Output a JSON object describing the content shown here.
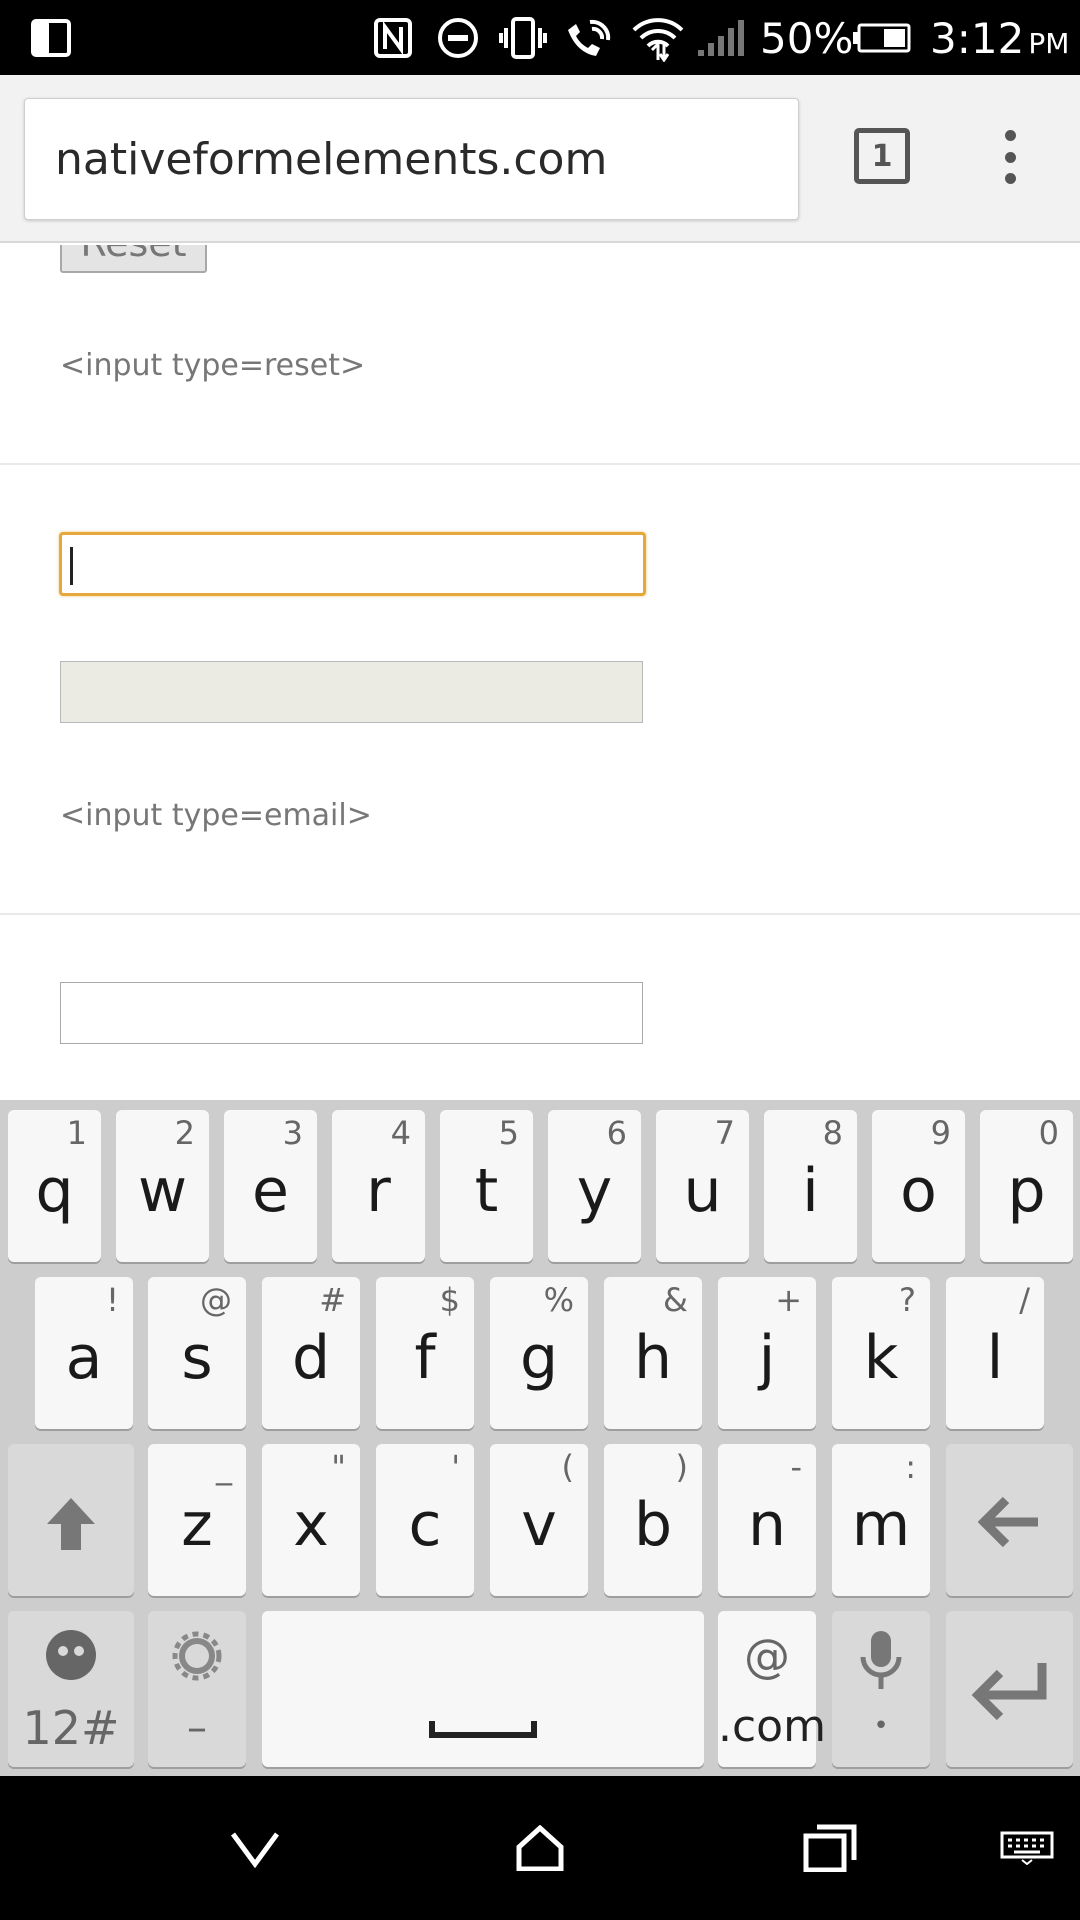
{
  "status_bar": {
    "battery": "50%",
    "time": "3:12",
    "ampm": "PM"
  },
  "browser": {
    "url": "nativeformelements.com",
    "tab_count": "1"
  },
  "page": {
    "reset_button_label": "Reset",
    "reset_caption": "<input type=reset>",
    "email_caption": "<input type=email>"
  },
  "keyboard": {
    "row1": [
      {
        "key": "q",
        "hint": "1"
      },
      {
        "key": "w",
        "hint": "2"
      },
      {
        "key": "e",
        "hint": "3"
      },
      {
        "key": "r",
        "hint": "4"
      },
      {
        "key": "t",
        "hint": "5"
      },
      {
        "key": "y",
        "hint": "6"
      },
      {
        "key": "u",
        "hint": "7"
      },
      {
        "key": "i",
        "hint": "8"
      },
      {
        "key": "o",
        "hint": "9"
      },
      {
        "key": "p",
        "hint": "0"
      }
    ],
    "row2": [
      {
        "key": "a",
        "hint": "!"
      },
      {
        "key": "s",
        "hint": "@"
      },
      {
        "key": "d",
        "hint": "#"
      },
      {
        "key": "f",
        "hint": "$"
      },
      {
        "key": "g",
        "hint": "%"
      },
      {
        "key": "h",
        "hint": "&"
      },
      {
        "key": "j",
        "hint": "+"
      },
      {
        "key": "k",
        "hint": "?"
      },
      {
        "key": "l",
        "hint": "/"
      }
    ],
    "row3": [
      {
        "key": "z",
        "hint": "_"
      },
      {
        "key": "x",
        "hint": "\""
      },
      {
        "key": "c",
        "hint": "'"
      },
      {
        "key": "v",
        "hint": "("
      },
      {
        "key": "b",
        "hint": ")"
      },
      {
        "key": "n",
        "hint": "-"
      },
      {
        "key": "m",
        "hint": ":"
      }
    ],
    "symbols_label": "12#",
    "settings_sub": "–",
    "at_label": "@",
    "dotcom_label": ".com",
    "mic_sub": "•"
  },
  "colors": {
    "focus_border": "#e6a83b",
    "keyboard_bg": "#cdcdcd",
    "key_bg": "#f7f7f7"
  }
}
